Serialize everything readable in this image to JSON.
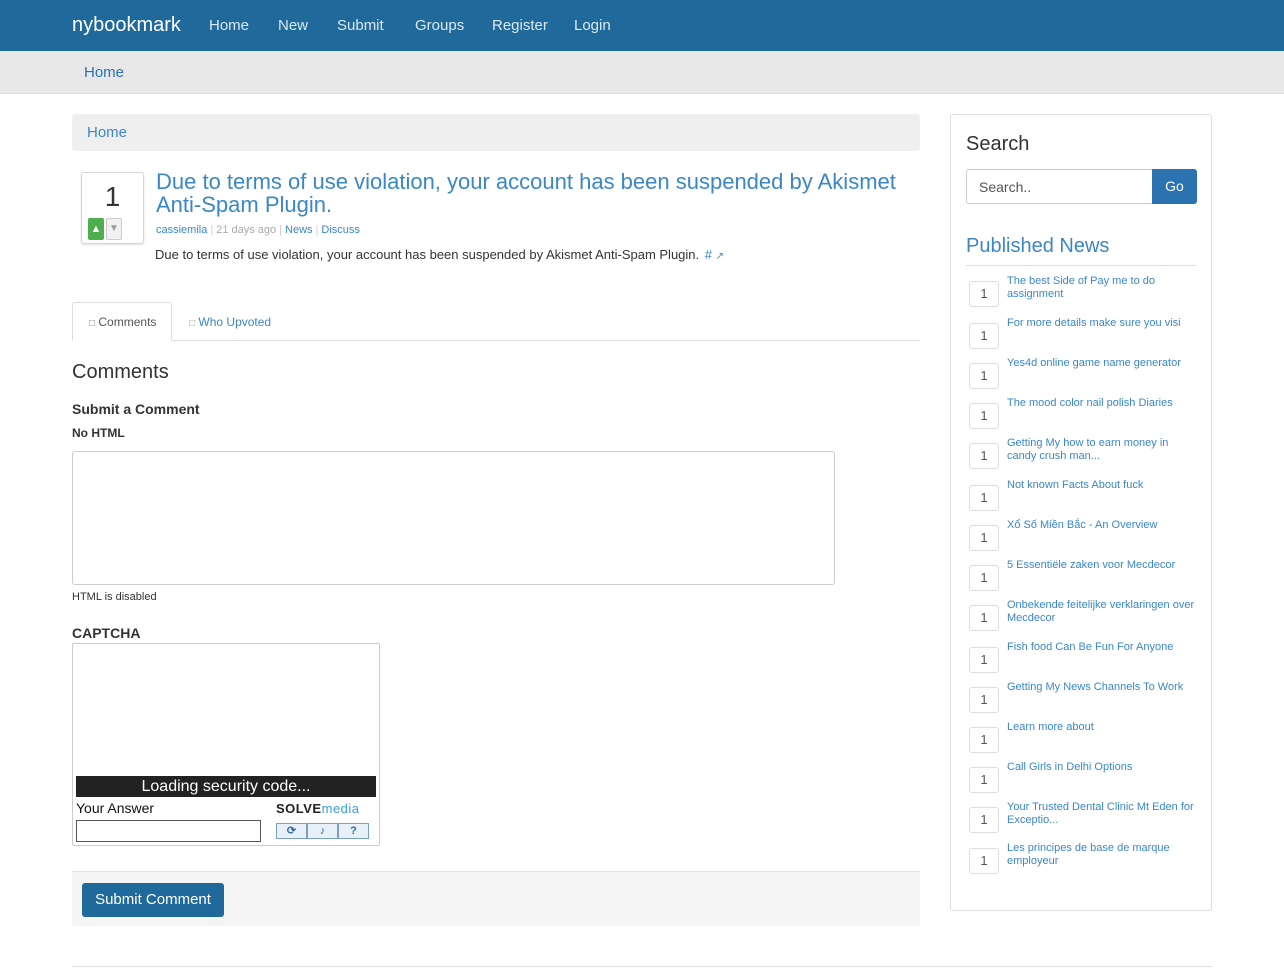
{
  "navbar": {
    "brand": "nybookmark",
    "items": [
      "Home",
      "New",
      "Submit",
      "Groups",
      "Register",
      "Login"
    ]
  },
  "subbar": {
    "home": "Home"
  },
  "breadcrumb": {
    "home": "Home"
  },
  "post": {
    "votes": "1",
    "vote_up_icon": "thumbs-up-icon",
    "vote_down_icon": "thumbs-down-icon",
    "title": "Due to terms of use violation, your account has been suspended by Akismet Anti-Spam Plugin.",
    "author": "cassiemila",
    "time": "21 days ago",
    "category": "News",
    "discuss": "Discuss",
    "description": "Due to terms of use violation, your account has been suspended by Akismet Anti-Spam Plugin.",
    "hash_link": "#"
  },
  "tabs": {
    "comments": "Comments",
    "who_upvoted": "Who Upvoted"
  },
  "comments": {
    "heading": "Comments",
    "submit_heading": "Submit a Comment",
    "no_html": "No HTML",
    "html_disabled": "HTML is disabled",
    "captcha_label": "CAPTCHA",
    "captcha_loading": "Loading security code...",
    "captcha_answer": "Your Answer",
    "solve_logo_a": "SOLVE",
    "solve_logo_b": "media",
    "submit_button": "Submit Comment"
  },
  "sidebar": {
    "search_title": "Search",
    "search_placeholder": "Search..",
    "go": "Go",
    "published_title": "Published News",
    "news": [
      {
        "count": "1",
        "title": "The best Side of Pay me to do assignment"
      },
      {
        "count": "1",
        "title": "For more details make sure you visi"
      },
      {
        "count": "1",
        "title": "Yes4d online game name generator"
      },
      {
        "count": "1",
        "title": "The mood color nail polish Diaries"
      },
      {
        "count": "1",
        "title": "Getting My how to earn money in candy crush man..."
      },
      {
        "count": "1",
        "title": "Not known Facts About fuck"
      },
      {
        "count": "1",
        "title": "Xổ Số Miền Bắc - An Overview"
      },
      {
        "count": "1",
        "title": "5 Essentiële zaken voor Mecdecor"
      },
      {
        "count": "1",
        "title": "Onbekende feitelijke verklaringen over Mecdecor"
      },
      {
        "count": "1",
        "title": "Fish food Can Be Fun For Anyone"
      },
      {
        "count": "1",
        "title": "Getting My News Channels To Work"
      },
      {
        "count": "1",
        "title": "Learn more about"
      },
      {
        "count": "1",
        "title": "Call Girls in Delhi Options"
      },
      {
        "count": "1",
        "title": "Your Trusted Dental Clinic Mt Eden for Exceptio..."
      },
      {
        "count": "1",
        "title": "Les principes de base de marque employeur"
      }
    ]
  }
}
